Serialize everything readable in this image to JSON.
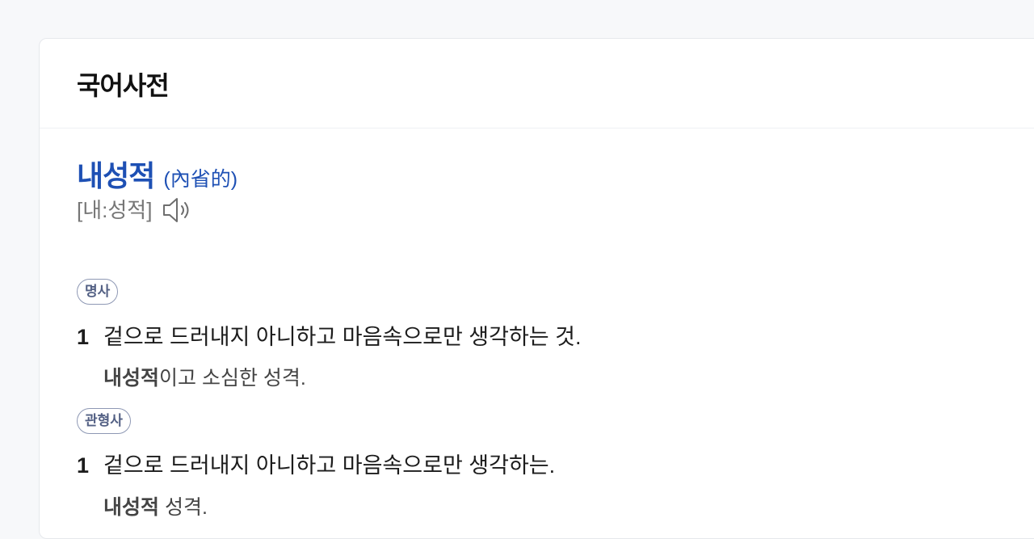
{
  "card": {
    "title": "국어사전"
  },
  "entry": {
    "headword": "내성적",
    "hanja": "(內省的)",
    "pronunciation": "[내:성적]",
    "speaker_icon": "speaker-icon",
    "colors": {
      "headword": "#1e50b4",
      "badge_text": "#536084",
      "badge_border": "#8e98b4"
    },
    "parts": [
      {
        "pos": "명사",
        "senses": [
          {
            "num": "1",
            "definition": "겉으로 드러내지 아니하고 마음속으로만 생각하는 것.",
            "example_bold": "내성적",
            "example_rest": "이고 소심한 성격."
          }
        ]
      },
      {
        "pos": "관형사",
        "senses": [
          {
            "num": "1",
            "definition": "겉으로 드러내지 아니하고 마음속으로만 생각하는.",
            "example_bold": "내성적",
            "example_rest": " 성격."
          }
        ]
      }
    ]
  }
}
